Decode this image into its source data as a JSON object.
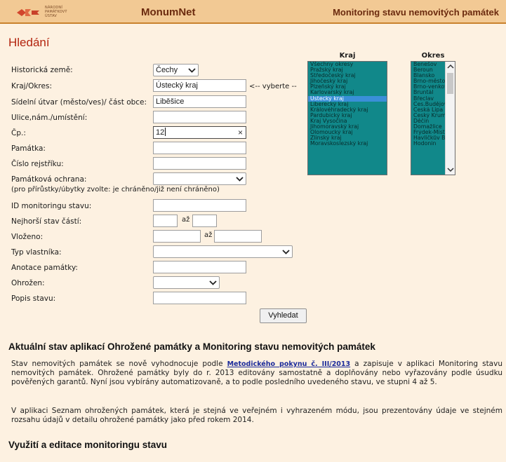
{
  "header": {
    "logo_lines": [
      "NÁRODNÍ",
      "PAMÁTKOVÝ",
      "ÚSTAV"
    ],
    "brand": "MonumNet",
    "app_title": "Monitoring stavu nemovitých památek"
  },
  "page_title": "Hledání",
  "form": {
    "historicka_zeme": {
      "label": "Historická země:",
      "value": "Čechy"
    },
    "kraj_okres": {
      "label": "Kraj/Okres:",
      "value": "Ústecký kraj",
      "hint": "<-- vyberte --"
    },
    "sidelni_utvar": {
      "label": "Sídelní útvar (město/ves)/ část obce:",
      "value": "Liběšice"
    },
    "ulice": {
      "label": "Ulice,nám./umístění:",
      "value": ""
    },
    "cp": {
      "label": "Čp.:",
      "value": "12",
      "clear": "×"
    },
    "pamatka": {
      "label": "Památka:",
      "value": ""
    },
    "cislo_rejstriku": {
      "label": "Číslo rejstříku:",
      "value": ""
    },
    "pamatkova_ochrana": {
      "label": "Památková ochrana:",
      "value": ""
    },
    "note": "(pro přírůstky/úbytky zvolte: je chráněno/již není chráněno)",
    "id_monitoringu": {
      "label": "ID monitoringu stavu:",
      "value": ""
    },
    "nejhorsi_stav": {
      "label": "Nejhorší stav částí:",
      "from": "",
      "to_label": "až",
      "to": ""
    },
    "vlozeno": {
      "label": "Vloženo:",
      "from": "",
      "to_label": "až",
      "to": ""
    },
    "typ_vlastnika": {
      "label": "Typ vlastníka:",
      "value": ""
    },
    "anotace": {
      "label": "Anotace památky:",
      "value": ""
    },
    "ohrozen": {
      "label": "Ohrožen:",
      "value": ""
    },
    "popis_stavu": {
      "label": "Popis stavu:",
      "value": ""
    },
    "search_button": "Vyhledat"
  },
  "kraj_list": {
    "header": "Kraj",
    "items": [
      "Všechny okresy",
      "Pražský kraj",
      "Středočeský kraj",
      "Jihočeský kraj",
      "Plzeňský kraj",
      "Karlovarský kraj",
      "Ústecký kraj",
      "Liberecký kraj",
      "Královéhradecký kraj",
      "Pardubický kraj",
      "Kraj Vysočina",
      "Jihomoravský kraj",
      "Olomoucký kraj",
      "Zlínský kraj",
      "Moravskoslezský kraj"
    ],
    "selected": "Ústecký kraj"
  },
  "okres_list": {
    "header": "Okres",
    "items": [
      "Benešov",
      "Beroun",
      "Blansko",
      "Brno-město",
      "Brno-venkov",
      "Bruntál",
      "Břeclav",
      "Čes.Budějovice",
      "Česká Lípa",
      "Český Krumlov",
      "Děčín",
      "Domažlice",
      "Frýdek-Místek",
      "Havlíčkův Brod",
      "Hodonín"
    ]
  },
  "section1": {
    "title": "Aktuální stav aplikací Ohrožené památky a Monitoring stavu nemovitých památek",
    "p1_before": "Stav nemovitých památek se nově vyhodnocuje podle ",
    "p1_link": "Metodického pokynu č. III/2013",
    "p1_after": " a zapisuje v aplikaci Monitoring stavu nemovitých památek. Ohrožené památky byly do r. 2013 editovány samostatně a doplňovány nebo vyřazovány podle úsudku pověřených garantů. Nyní jsou vybírány automatizovaně, a to podle posledního uvedeného stavu, ve stupni 4 až 5.",
    "p2": "V aplikaci Seznam ohrožených památek, která je stejná ve veřejném i vyhrazeném módu, jsou prezentovány údaje ve stejném rozsahu údajů v detailu ohrožené památky jako před rokem 2014."
  },
  "section2": {
    "title": "Využití a editace monitoringu stavu"
  },
  "colors": {
    "header_bg": "#f2c994",
    "page_bg": "#fdf1e1",
    "title_red": "#b3240e",
    "listbox_bg": "#11888a",
    "selection": "#3a8fd8"
  }
}
